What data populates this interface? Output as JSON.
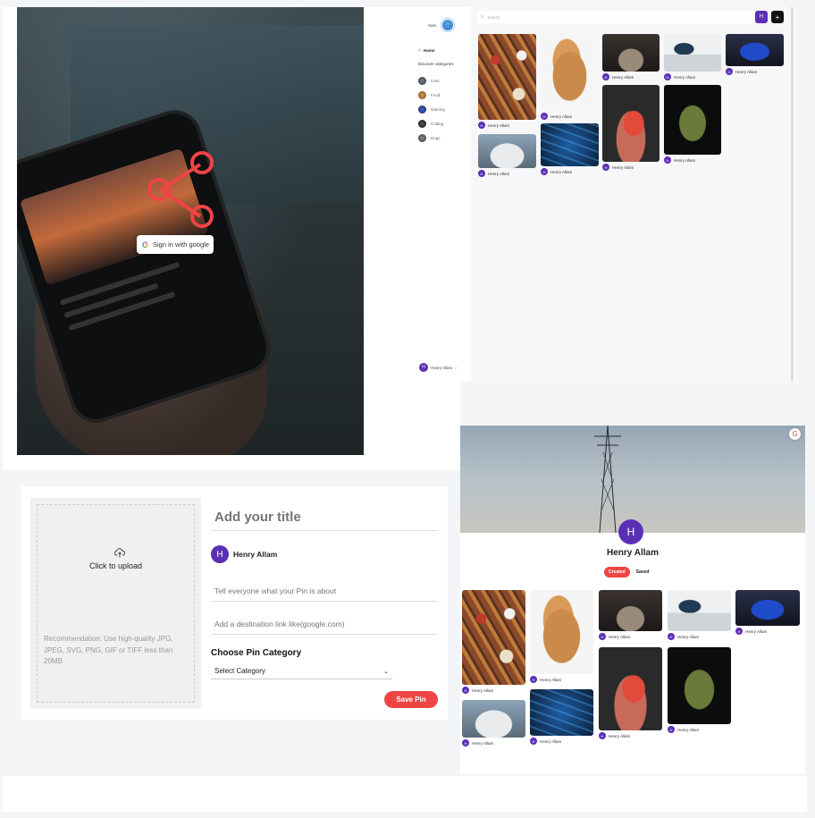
{
  "login": {
    "google_button": "Sign in with google"
  },
  "home": {
    "user_label": "Sam",
    "search_placeholder": "Search",
    "avatar_button": "H",
    "add_button": "+",
    "sidebar_home": "Home",
    "discover_label": "Discover categories",
    "categories": [
      "Cars",
      "Food",
      "Gaming",
      "Coding",
      "Dogs"
    ],
    "bottom_user": "Henry Allam",
    "pin_author": "Henry Allam"
  },
  "create": {
    "title_placeholder": "Add your title",
    "upload_icon": "upload-cloud-icon",
    "upload_text": "Click to upload",
    "recommendation": "Recommendation: Use high-quality JPG, JPEG, SVG, PNG, GIF or TIFF less than 20MB",
    "author_initial": "H",
    "author_name": "Henry Allam",
    "about_placeholder": "Tell everyone what your Pin is about",
    "link_placeholder": "Add a destination link like(google.com)",
    "category_label": "Choose Pin Category",
    "select_value": "Select Category",
    "save_button": "Save Pin"
  },
  "profile": {
    "initial": "H",
    "name": "Henry Allam",
    "tab_created": "Created",
    "tab_saved": "Saved",
    "pin_author": "Henry Allam"
  },
  "colors": {
    "accent_purple": "#5b2fb5",
    "accent_red": "#ef4444"
  }
}
